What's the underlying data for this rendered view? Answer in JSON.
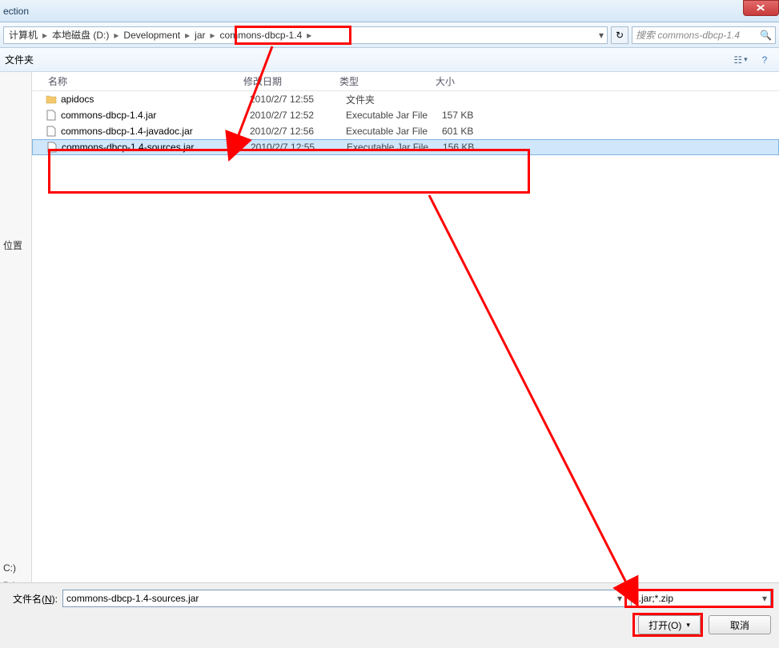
{
  "title": "ection",
  "breadcrumb": [
    {
      "label": "计算机"
    },
    {
      "label": "本地磁盘 (D:)"
    },
    {
      "label": "Development"
    },
    {
      "label": "jar"
    },
    {
      "label": "commons-dbcp-1.4"
    }
  ],
  "search_placeholder": "搜索 commons-dbcp-1.4",
  "toolbar": {
    "new_folder": "文件夹"
  },
  "columns": {
    "name": "名称",
    "date": "修改日期",
    "type": "类型",
    "size": "大小"
  },
  "files": [
    {
      "icon": "folder",
      "name": "apidocs",
      "date": "2010/2/7 12:55",
      "type": "文件夹",
      "size": "",
      "selected": false
    },
    {
      "icon": "file",
      "name": "commons-dbcp-1.4.jar",
      "date": "2010/2/7 12:52",
      "type": "Executable Jar File",
      "size": "157 KB",
      "selected": false
    },
    {
      "icon": "file",
      "name": "commons-dbcp-1.4-javadoc.jar",
      "date": "2010/2/7 12:56",
      "type": "Executable Jar File",
      "size": "601 KB",
      "selected": false
    },
    {
      "icon": "file",
      "name": "commons-dbcp-1.4-sources.jar",
      "date": "2010/2/7 12:55",
      "type": "Executable Jar File",
      "size": "156 KB",
      "selected": true
    }
  ],
  "sidebar": {
    "location_label": "位置",
    "d0": "C:)",
    "d1": "D:)"
  },
  "filebar": {
    "label_pre": "文件名(",
    "label_und": "N",
    "label_post": "):",
    "value": "commons-dbcp-1.4-sources.jar",
    "type_filter": "*.jar;*.zip",
    "open": "打开(O)",
    "cancel": "取消"
  }
}
